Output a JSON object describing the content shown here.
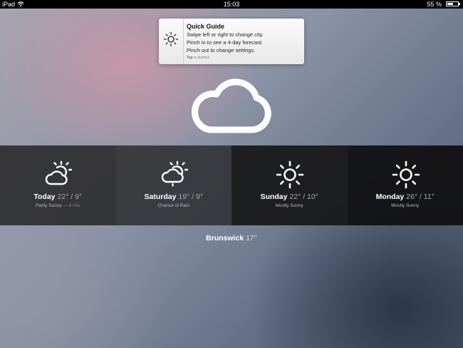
{
  "status_bar": {
    "carrier": "iPad",
    "time": "15:03",
    "battery": "55 %",
    "battery_level": 0.55
  },
  "quick_guide": {
    "title": "Quick Guide",
    "lines": [
      "Swipe left or right to change city.",
      "Pinch in to see a 4-day forecast.",
      "Pinch out to change settings."
    ],
    "dismiss_strong": "Tap",
    "dismiss_rest": "to dismiss",
    "icon": "sun-icon"
  },
  "current": {
    "icon": "cloud-icon",
    "city": "Brunswick",
    "temp": "17°"
  },
  "forecast": [
    {
      "day": "Today",
      "temps": "22° / 9°",
      "desc": "Partly Sunny",
      "extra": "— 6 m/s",
      "icon": "partly-sunny-icon"
    },
    {
      "day": "Saturday",
      "temps": "19° / 9°",
      "desc": "Chance of Rain",
      "extra": "",
      "icon": "sun-cloud-rain-icon"
    },
    {
      "day": "Sunday",
      "temps": "22° / 10°",
      "desc": "Mostly Sunny",
      "extra": "",
      "icon": "sun-icon"
    },
    {
      "day": "Monday",
      "temps": "26° / 11°",
      "desc": "Mostly Sunny",
      "extra": "",
      "icon": "sun-icon"
    }
  ]
}
